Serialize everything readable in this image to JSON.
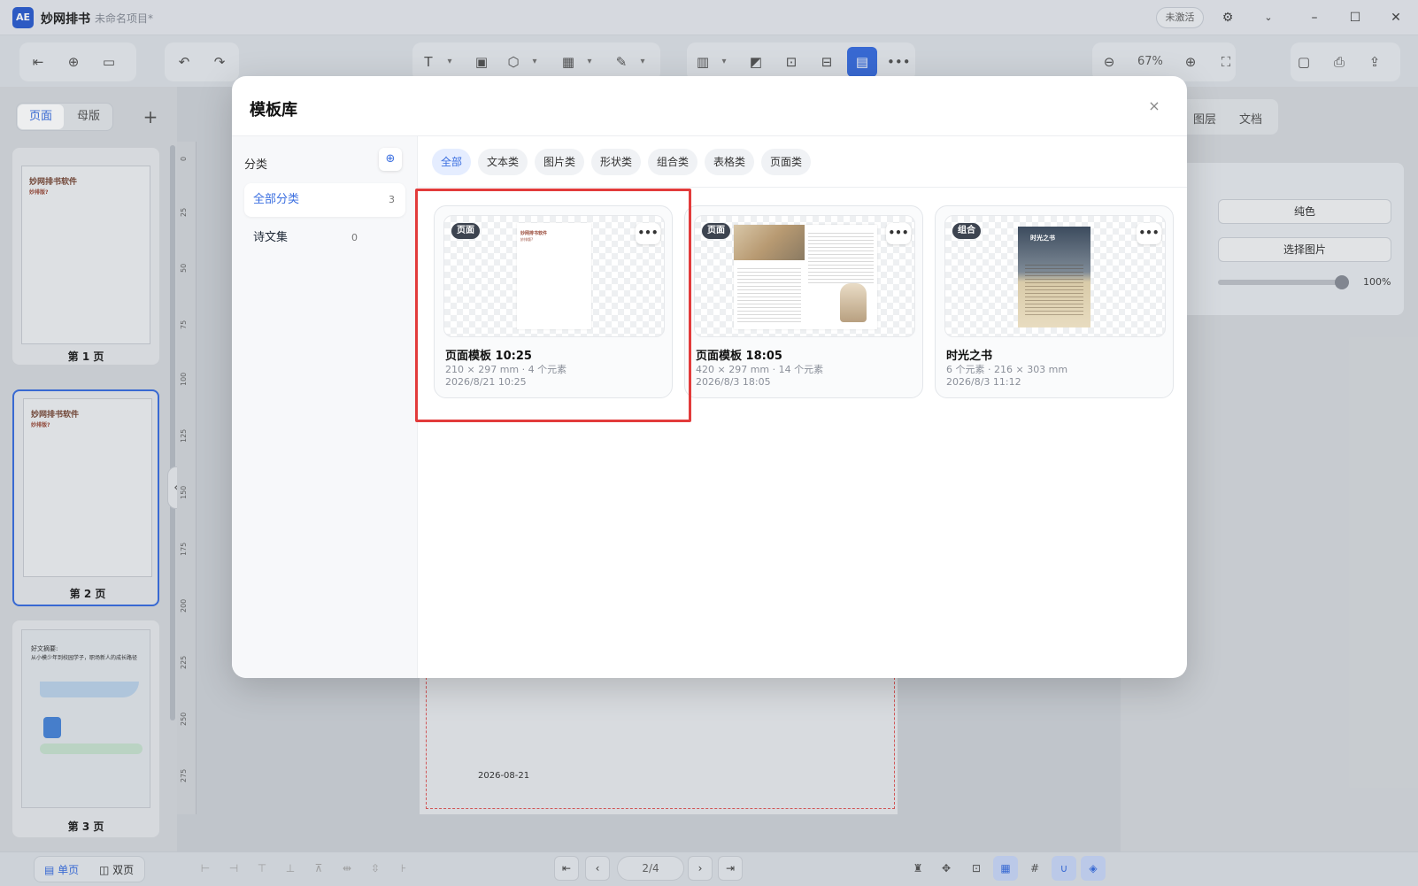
{
  "app": {
    "logo": "AE",
    "name": "妙网排书",
    "project": "未命名项目*",
    "activation": "未激活"
  },
  "toolbar": {
    "zoom": "67%"
  },
  "sidebar": {
    "tabs": [
      "页面",
      "母版"
    ],
    "pages": [
      {
        "label": "第 1 页",
        "title": "妙网排书软件",
        "subtitle": "妙排版?"
      },
      {
        "label": "第 2 页",
        "title": "妙网排书软件",
        "subtitle": "妙排版?"
      },
      {
        "label": "第 3 页",
        "title": "好文摘要:",
        "subtitle": "从小模少年到校园学子，职场新人的成长路径"
      }
    ],
    "view_modes": [
      "单页",
      "双页"
    ]
  },
  "ruler": [
    "0",
    "25",
    "50",
    "75",
    "100",
    "125",
    "150",
    "175",
    "200",
    "225",
    "250",
    "275"
  ],
  "canvas": {
    "date": "2026-08-21"
  },
  "right_panel": {
    "tabs": [
      "图层",
      "文档"
    ],
    "fill_btn": "纯色",
    "image_btn": "选择图片",
    "opacity": "100%"
  },
  "modal": {
    "title": "模板库",
    "close": "×",
    "side_label": "分类",
    "categories": [
      {
        "name": "全部分类",
        "count": "3"
      },
      {
        "name": "诗文集",
        "count": "0"
      }
    ],
    "filters": [
      "全部",
      "文本类",
      "图片类",
      "形状类",
      "组合类",
      "表格类",
      "页面类"
    ],
    "cards": [
      {
        "tag": "页面",
        "name": "页面模板 10:25",
        "meta1": "210 × 297 mm · 4 个元素",
        "meta2": "2026/8/21 10:25",
        "preview_title": "妙网排书软件",
        "preview_sub": "妙排版?"
      },
      {
        "tag": "页面",
        "name": "页面模板 18:05",
        "meta1": "420 × 297 mm · 14 个元素",
        "meta2": "2026/8/3 18:05"
      },
      {
        "tag": "组合",
        "name": "时光之书",
        "meta1": "6 个元素 · 216 × 303 mm",
        "meta2": "2026/8/3 11:12",
        "preview_title": "时光之书"
      }
    ]
  },
  "pagination": {
    "current": "2/4"
  }
}
